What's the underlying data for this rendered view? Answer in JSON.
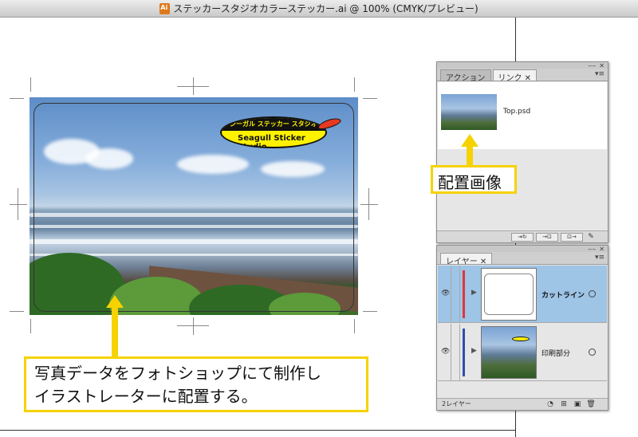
{
  "window": {
    "title": "ステッカースタジオカラーステッカー.ai @ 100% (CMYK/プレビュー)",
    "app_icon": "illustrator-doc-icon"
  },
  "artwork": {
    "logo_text_jp": "シーガル ステッカー スタジオ",
    "logo_text_en": "Seagull Sticker Studio",
    "colors": {
      "logo_fill": "#fff200",
      "surfboard": "#e83820"
    }
  },
  "callouts": {
    "main_line1": "写真データをフォトショップにて制作し",
    "main_line2": "イラストレーターに配置する。",
    "placed_image": "配置画像",
    "accent": "#f6d200"
  },
  "links_panel": {
    "tabs": [
      "アクション",
      "リンク"
    ],
    "active_tab": "リンク",
    "items": [
      {
        "name": "Top.psd"
      }
    ],
    "footer_buttons": [
      "⇥↻",
      "→⊡",
      "⊡→",
      "✎"
    ]
  },
  "layers_panel": {
    "tab": "レイヤー",
    "layers": [
      {
        "name": "カットライン",
        "color": "#e0363a",
        "selected": true
      },
      {
        "name": "印刷部分",
        "color": "#2b4fae",
        "selected": false
      }
    ],
    "status": "2レイヤー",
    "footer_icons": [
      "clip-mask-icon",
      "new-sublayer-icon",
      "new-layer-icon",
      "trash-icon"
    ]
  }
}
